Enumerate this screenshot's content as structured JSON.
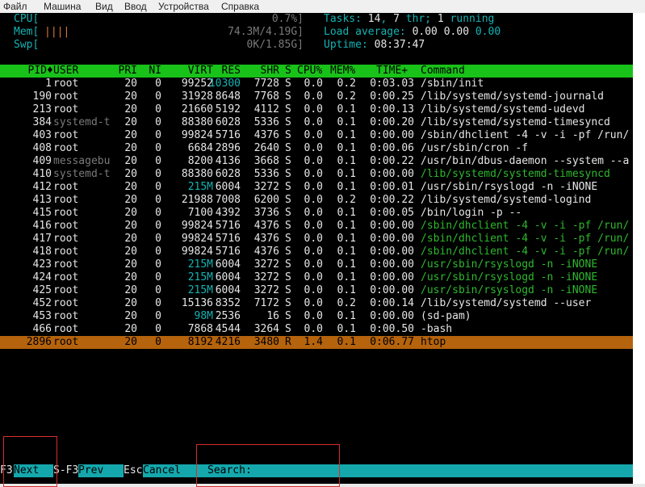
{
  "menu": [
    "Файл",
    "Машина",
    "Вид",
    "Ввод",
    "Устройства",
    "Справка"
  ],
  "meters": {
    "cpu": {
      "label": "CPU[",
      "value": "0.7%]"
    },
    "mem": {
      "label": "Mem[",
      "bar": "||||",
      "value": "74.3M/4.19G]"
    },
    "swp": {
      "label": "Swp[",
      "value": "0K/1.85G]"
    }
  },
  "summary": {
    "tasks_label": "Tasks: ",
    "tasks": "14",
    "sep": ", ",
    "thr": "7",
    "thr_label": " thr; ",
    "running": "1",
    "running_label": " running",
    "load_label": "Load average: ",
    "load1": "0.00",
    "load5": "0.00",
    "load15": "0.00",
    "uptime_label": "Uptime: ",
    "uptime": "08:37:47"
  },
  "columns": {
    "pid": "PID",
    "sort_icon": "♦",
    "user": "USER",
    "pri": "PRI",
    "ni": "NI",
    "virt": "VIRT",
    "res": "RES",
    "shr": "SHR",
    "s": "S",
    "cpu": "CPU%",
    "mem": "MEM%",
    "time": "TIME+",
    "cmd": "Command"
  },
  "processes": [
    {
      "pid": "1",
      "user": "root",
      "pri": "20",
      "ni": "0",
      "virt": "99252",
      "res": "10300",
      "shr": "7728",
      "s": "S",
      "cpu": "0.0",
      "mem": "0.2",
      "time": "0:03.03",
      "cmd": "/sbin/init",
      "user_dim": false,
      "thread": false,
      "sel": false
    },
    {
      "pid": "190",
      "user": "root",
      "pri": "20",
      "ni": "0",
      "virt": "31928",
      "res": "8648",
      "shr": "7768",
      "s": "S",
      "cpu": "0.0",
      "mem": "0.2",
      "time": "0:00.25",
      "cmd": "/lib/systemd/systemd-journald",
      "user_dim": false,
      "thread": false,
      "sel": false
    },
    {
      "pid": "213",
      "user": "root",
      "pri": "20",
      "ni": "0",
      "virt": "21660",
      "res": "5192",
      "shr": "4112",
      "s": "S",
      "cpu": "0.0",
      "mem": "0.1",
      "time": "0:00.13",
      "cmd": "/lib/systemd/systemd-udevd",
      "user_dim": false,
      "thread": false,
      "sel": false
    },
    {
      "pid": "384",
      "user": "systemd-t",
      "pri": "20",
      "ni": "0",
      "virt": "88380",
      "res": "6028",
      "shr": "5336",
      "s": "S",
      "cpu": "0.0",
      "mem": "0.1",
      "time": "0:00.20",
      "cmd": "/lib/systemd/systemd-timesyncd",
      "user_dim": true,
      "thread": false,
      "sel": false
    },
    {
      "pid": "403",
      "user": "root",
      "pri": "20",
      "ni": "0",
      "virt": "99824",
      "res": "5716",
      "shr": "4376",
      "s": "S",
      "cpu": "0.0",
      "mem": "0.1",
      "time": "0:00.00",
      "cmd": "/sbin/dhclient -4 -v -i -pf /run/",
      "user_dim": false,
      "thread": false,
      "sel": false
    },
    {
      "pid": "408",
      "user": "root",
      "pri": "20",
      "ni": "0",
      "virt": "6684",
      "res": "2896",
      "shr": "2640",
      "s": "S",
      "cpu": "0.0",
      "mem": "0.1",
      "time": "0:00.06",
      "cmd": "/usr/sbin/cron -f",
      "user_dim": false,
      "thread": false,
      "sel": false
    },
    {
      "pid": "409",
      "user": "messagebu",
      "pri": "20",
      "ni": "0",
      "virt": "8200",
      "res": "4136",
      "shr": "3668",
      "s": "S",
      "cpu": "0.0",
      "mem": "0.1",
      "time": "0:00.22",
      "cmd": "/usr/bin/dbus-daemon --system --a",
      "user_dim": true,
      "thread": false,
      "sel": false
    },
    {
      "pid": "410",
      "user": "systemd-t",
      "pri": "20",
      "ni": "0",
      "virt": "88380",
      "res": "6028",
      "shr": "5336",
      "s": "S",
      "cpu": "0.0",
      "mem": "0.1",
      "time": "0:00.00",
      "cmd": "/lib/systemd/systemd-timesyncd",
      "user_dim": true,
      "thread": true,
      "sel": false
    },
    {
      "pid": "412",
      "user": "root",
      "pri": "20",
      "ni": "0",
      "virt": "215M",
      "res": "6004",
      "shr": "3272",
      "s": "S",
      "cpu": "0.0",
      "mem": "0.1",
      "time": "0:00.01",
      "cmd": "/usr/sbin/rsyslogd -n -iNONE",
      "user_dim": false,
      "thread": false,
      "sel": false
    },
    {
      "pid": "413",
      "user": "root",
      "pri": "20",
      "ni": "0",
      "virt": "21988",
      "res": "7008",
      "shr": "6200",
      "s": "S",
      "cpu": "0.0",
      "mem": "0.2",
      "time": "0:00.22",
      "cmd": "/lib/systemd/systemd-logind",
      "user_dim": false,
      "thread": false,
      "sel": false
    },
    {
      "pid": "415",
      "user": "root",
      "pri": "20",
      "ni": "0",
      "virt": "7100",
      "res": "4392",
      "shr": "3736",
      "s": "S",
      "cpu": "0.0",
      "mem": "0.1",
      "time": "0:00.05",
      "cmd": "/bin/login -p --",
      "user_dim": false,
      "thread": false,
      "sel": false
    },
    {
      "pid": "416",
      "user": "root",
      "pri": "20",
      "ni": "0",
      "virt": "99824",
      "res": "5716",
      "shr": "4376",
      "s": "S",
      "cpu": "0.0",
      "mem": "0.1",
      "time": "0:00.00",
      "cmd": "/sbin/dhclient -4 -v -i -pf /run/",
      "user_dim": false,
      "thread": true,
      "sel": false
    },
    {
      "pid": "417",
      "user": "root",
      "pri": "20",
      "ni": "0",
      "virt": "99824",
      "res": "5716",
      "shr": "4376",
      "s": "S",
      "cpu": "0.0",
      "mem": "0.1",
      "time": "0:00.00",
      "cmd": "/sbin/dhclient -4 -v -i -pf /run/",
      "user_dim": false,
      "thread": true,
      "sel": false
    },
    {
      "pid": "418",
      "user": "root",
      "pri": "20",
      "ni": "0",
      "virt": "99824",
      "res": "5716",
      "shr": "4376",
      "s": "S",
      "cpu": "0.0",
      "mem": "0.1",
      "time": "0:00.00",
      "cmd": "/sbin/dhclient -4 -v -i -pf /run/",
      "user_dim": false,
      "thread": true,
      "sel": false
    },
    {
      "pid": "423",
      "user": "root",
      "pri": "20",
      "ni": "0",
      "virt": "215M",
      "res": "6004",
      "shr": "3272",
      "s": "S",
      "cpu": "0.0",
      "mem": "0.1",
      "time": "0:00.00",
      "cmd": "/usr/sbin/rsyslogd -n -iNONE",
      "user_dim": false,
      "thread": true,
      "sel": false
    },
    {
      "pid": "424",
      "user": "root",
      "pri": "20",
      "ni": "0",
      "virt": "215M",
      "res": "6004",
      "shr": "3272",
      "s": "S",
      "cpu": "0.0",
      "mem": "0.1",
      "time": "0:00.00",
      "cmd": "/usr/sbin/rsyslogd -n -iNONE",
      "user_dim": false,
      "thread": true,
      "sel": false
    },
    {
      "pid": "425",
      "user": "root",
      "pri": "20",
      "ni": "0",
      "virt": "215M",
      "res": "6004",
      "shr": "3272",
      "s": "S",
      "cpu": "0.0",
      "mem": "0.1",
      "time": "0:00.00",
      "cmd": "/usr/sbin/rsyslogd -n -iNONE",
      "user_dim": false,
      "thread": true,
      "sel": false
    },
    {
      "pid": "452",
      "user": "root",
      "pri": "20",
      "ni": "0",
      "virt": "15136",
      "res": "8352",
      "shr": "7172",
      "s": "S",
      "cpu": "0.0",
      "mem": "0.2",
      "time": "0:00.14",
      "cmd": "/lib/systemd/systemd --user",
      "user_dim": false,
      "thread": false,
      "sel": false
    },
    {
      "pid": "453",
      "user": "root",
      "pri": "20",
      "ni": "0",
      "virt": "98M",
      "res": "2536",
      "shr": "16",
      "s": "S",
      "cpu": "0.0",
      "mem": "0.1",
      "time": "0:00.00",
      "cmd": "(sd-pam)",
      "user_dim": false,
      "thread": false,
      "sel": false
    },
    {
      "pid": "466",
      "user": "root",
      "pri": "20",
      "ni": "0",
      "virt": "7868",
      "res": "4544",
      "shr": "3264",
      "s": "S",
      "cpu": "0.0",
      "mem": "0.1",
      "time": "0:00.50",
      "cmd": "-bash",
      "user_dim": false,
      "thread": false,
      "sel": false
    },
    {
      "pid": "2896",
      "user": "root",
      "pri": "20",
      "ni": "0",
      "virt": "8192",
      "res": "4216",
      "shr": "3480",
      "s": "R",
      "cpu": "1.4",
      "mem": "0.1",
      "time": "0:06.77",
      "cmd": "htop",
      "user_dim": false,
      "thread": false,
      "sel": true
    }
  ],
  "footer": {
    "next_key": "F3",
    "next_label": "Next",
    "prev_key": "S-F3",
    "prev_label": "Prev",
    "cancel_key": "Esc",
    "cancel_label": "Cancel",
    "search_label": "Search: ",
    "search_value": ""
  },
  "colors": {
    "accent": "#14a8ad",
    "header_bar": "#19c219",
    "selected_row": "#b5630c",
    "thread_text": "#2eb82e"
  }
}
